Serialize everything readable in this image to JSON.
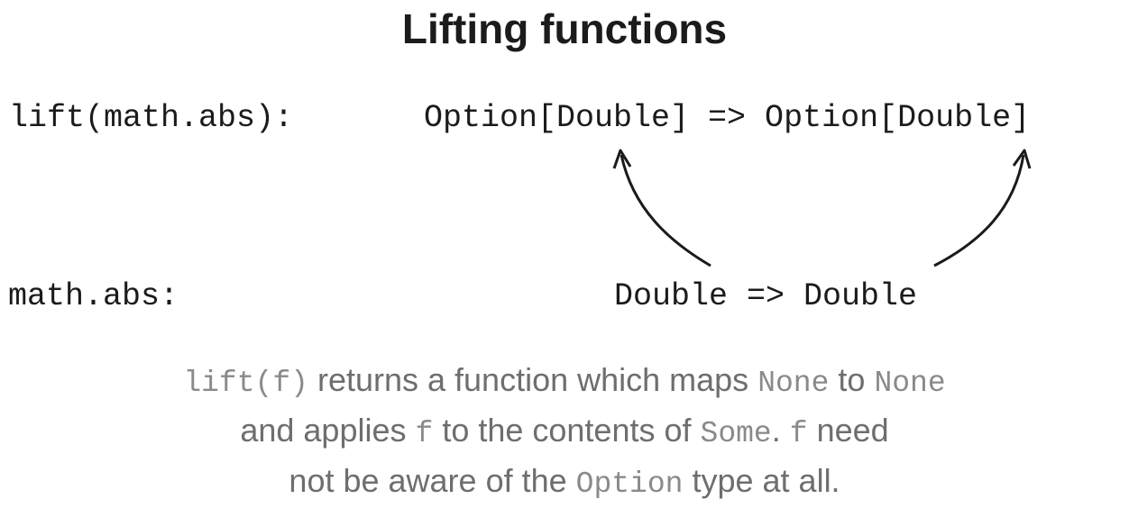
{
  "title": "Lifting functions",
  "lifted": {
    "label": "lift(math.abs):",
    "type": "Option[Double] => Option[Double]"
  },
  "base": {
    "label": "math.abs:",
    "type": "Double => Double"
  },
  "caption": {
    "l1_code1": "lift(f)",
    "l1_text1": " returns a function which maps ",
    "l1_code2": "None",
    "l1_text2": " to ",
    "l1_code3": "None",
    "l2_text1": "and applies ",
    "l2_code1": "f",
    "l2_text2": " to the contents of ",
    "l2_code2": "Some",
    "l2_text3": ". ",
    "l2_code3": "f",
    "l2_text4": " need",
    "l3_text1": "not be aware of the ",
    "l3_code1": "Option",
    "l3_text2": " type at all."
  }
}
